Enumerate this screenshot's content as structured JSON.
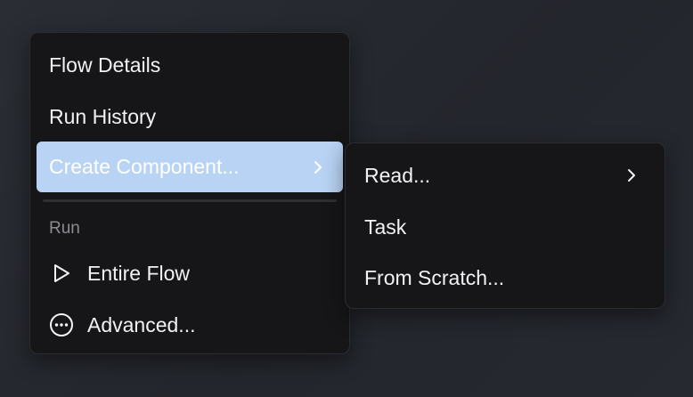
{
  "main_menu": {
    "items": [
      {
        "label": "Flow Details"
      },
      {
        "label": "Run History"
      },
      {
        "label": "Create Component...",
        "icon": "chevron-right-icon",
        "highlighted": true
      }
    ],
    "section": {
      "label": "Run",
      "items": [
        {
          "label": "Entire Flow",
          "icon": "play-icon"
        },
        {
          "label": "Advanced...",
          "icon": "more-circle-icon"
        }
      ]
    }
  },
  "sub_menu": {
    "items": [
      {
        "label": "Read...",
        "icon": "chevron-right-icon"
      },
      {
        "label": "Task"
      },
      {
        "label": "From Scratch..."
      }
    ]
  },
  "colors": {
    "highlight": "#b9d3f5",
    "menu_background": "#161618",
    "text": "#f2f2f4",
    "section_label": "#8c8d93"
  }
}
